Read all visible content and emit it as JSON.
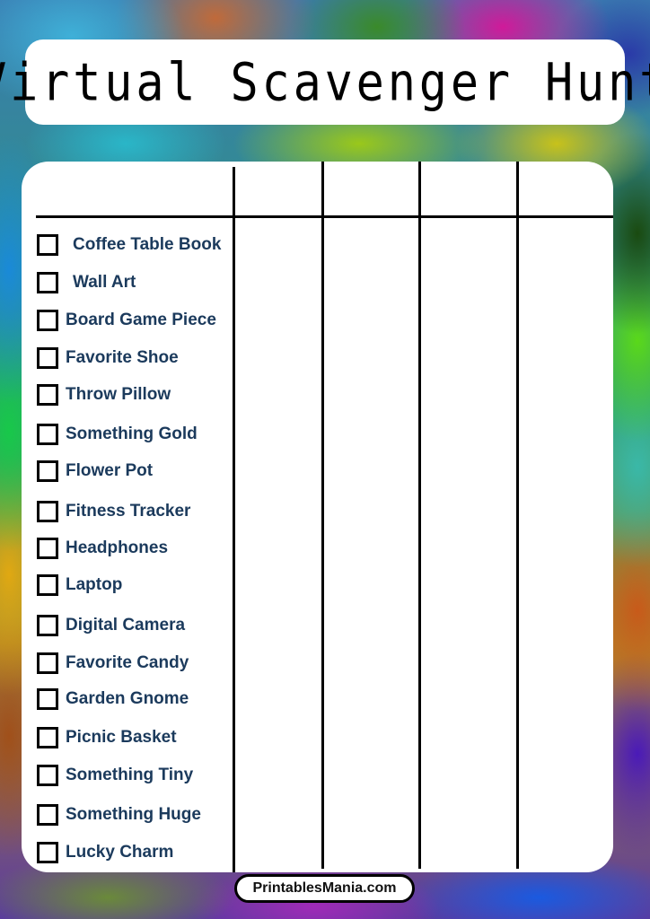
{
  "title": "Virtual Scavenger Hunt",
  "columns": {
    "count": 5,
    "headers": [
      "",
      "",
      "",
      "",
      ""
    ]
  },
  "items": [
    {
      "label": "Coffee Table Book",
      "checked": false
    },
    {
      "label": "Wall Art",
      "checked": false
    },
    {
      "label": "Board Game Piece",
      "checked": false
    },
    {
      "label": "Favorite Shoe",
      "checked": false
    },
    {
      "label": "Throw Pillow",
      "checked": false
    },
    {
      "label": "Something Gold",
      "checked": false
    },
    {
      "label": "Flower Pot",
      "checked": false
    },
    {
      "label": "Fitness Tracker",
      "checked": false
    },
    {
      "label": "Headphones",
      "checked": false
    },
    {
      "label": "Laptop",
      "checked": false
    },
    {
      "label": "Digital Camera",
      "checked": false
    },
    {
      "label": "Favorite Candy",
      "checked": false
    },
    {
      "label": "Garden Gnome",
      "checked": false
    },
    {
      "label": "Picnic Basket",
      "checked": false
    },
    {
      "label": "Something Tiny",
      "checked": false
    },
    {
      "label": "Something Huge",
      "checked": false
    },
    {
      "label": "Lucky Charm",
      "checked": false
    }
  ],
  "footer": {
    "site": "PrintablesMania.com"
  },
  "colors": {
    "item_text": "#1b3a5c",
    "grid_lines": "#000000",
    "panel": "#ffffff"
  }
}
